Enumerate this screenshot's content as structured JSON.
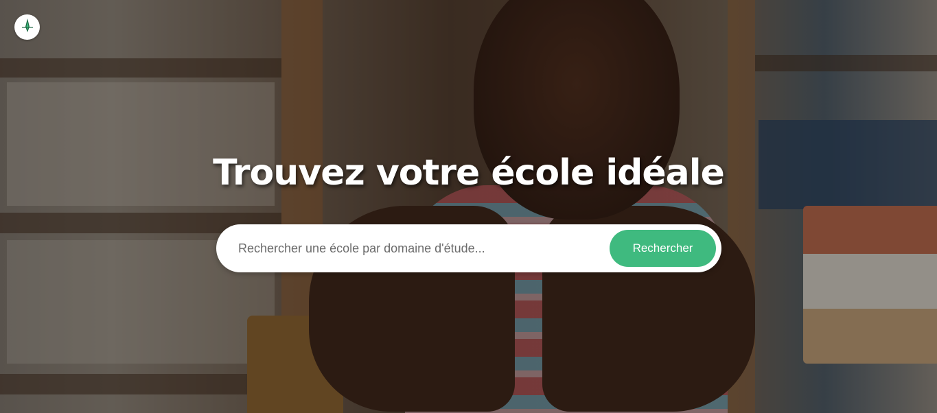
{
  "header": {
    "logo_icon": "compass-leaf-logo-icon"
  },
  "hero": {
    "title": "Trouvez votre école idéale",
    "background_image": "child-in-library-photo"
  },
  "search": {
    "placeholder": "Rechercher une école par domaine d'étude...",
    "value": "",
    "button_label": "Rechercher"
  },
  "colors": {
    "accent": "#3fba7f",
    "title_text": "#ffffff",
    "search_background": "#ffffff"
  }
}
